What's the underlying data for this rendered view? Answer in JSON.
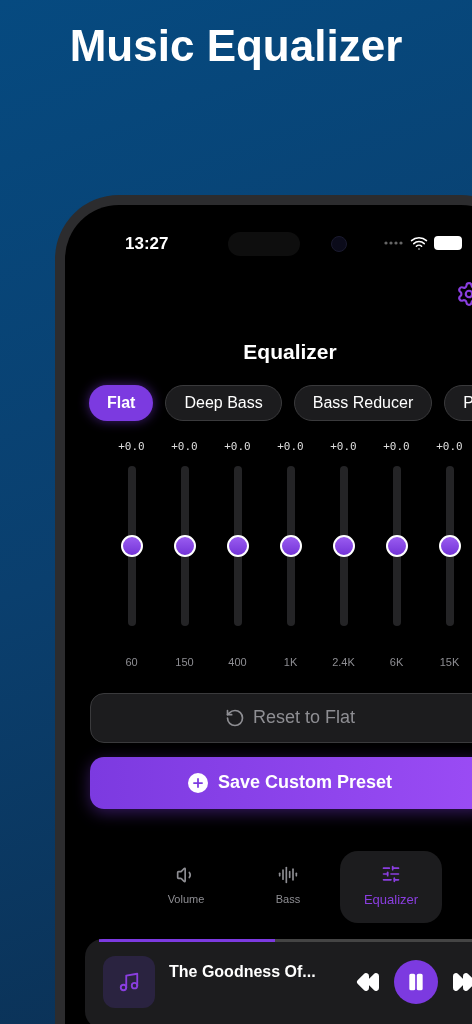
{
  "headline": "Music Equalizer",
  "status_bar": {
    "time": "13:27"
  },
  "title": "Equalizer",
  "presets": [
    {
      "label": "Flat",
      "selected": true
    },
    {
      "label": "Deep Bass",
      "selected": false
    },
    {
      "label": "Bass Reducer",
      "selected": false
    },
    {
      "label": "P",
      "selected": false
    }
  ],
  "bands": [
    {
      "gain": "+0.0",
      "frequency": "60",
      "level": 0.5
    },
    {
      "gain": "+0.0",
      "frequency": "150",
      "level": 0.5
    },
    {
      "gain": "+0.0",
      "frequency": "400",
      "level": 0.5
    },
    {
      "gain": "+0.0",
      "frequency": "1K",
      "level": 0.5
    },
    {
      "gain": "+0.0",
      "frequency": "2.4K",
      "level": 0.5
    },
    {
      "gain": "+0.0",
      "frequency": "6K",
      "level": 0.5
    },
    {
      "gain": "+0.0",
      "frequency": "15K",
      "level": 0.5
    }
  ],
  "reset_button": {
    "label": "Reset to Flat"
  },
  "save_button": {
    "label": "Save Custom Preset"
  },
  "tabs": [
    {
      "kind": "volume",
      "label": "Volume",
      "selected": false
    },
    {
      "kind": "bass",
      "label": "Bass",
      "selected": false
    },
    {
      "kind": "equalizer",
      "label": "Equalizer",
      "selected": true
    }
  ],
  "player": {
    "title": "The Goodness Of...",
    "level": 0.45
  }
}
